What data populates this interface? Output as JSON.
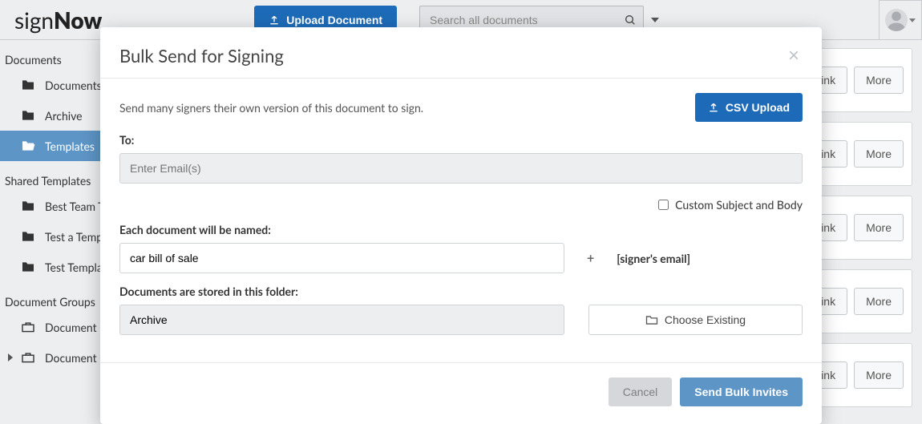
{
  "brand": {
    "prefix": "sign",
    "suffix": "Now"
  },
  "topbar": {
    "upload_label": "Upload Document",
    "search_placeholder": "Search all documents"
  },
  "sidebar": {
    "sections": [
      {
        "title": "Documents",
        "items": [
          {
            "label": "Documents"
          },
          {
            "label": "Archive"
          },
          {
            "label": "Templates",
            "active": true
          }
        ]
      },
      {
        "title": "Shared Templates",
        "items": [
          {
            "label": "Best Team Templates"
          },
          {
            "label": "Test a Template"
          },
          {
            "label": "Test Templates"
          }
        ]
      },
      {
        "title": "Document Groups",
        "items": [
          {
            "label": "Document Groups"
          },
          {
            "label": "Document Group Templates"
          }
        ]
      }
    ]
  },
  "card_buttons": {
    "link": "Signing Link",
    "more": "More"
  },
  "modal": {
    "title": "Bulk Send for Signing",
    "description": "Send many signers their own version of this document to sign.",
    "csv_upload": "CSV Upload",
    "to_label": "To:",
    "to_placeholder": "Enter Email(s)",
    "custom_subject_label": "Custom Subject and Body",
    "name_label": "Each document will be named:",
    "name_value": "car bill of sale",
    "name_plus": "+",
    "name_suffix": "[signer's email]",
    "folder_label": "Documents are stored in this folder:",
    "folder_value": "Archive",
    "choose_existing": "Choose Existing",
    "cancel": "Cancel",
    "send": "Send Bulk Invites"
  }
}
